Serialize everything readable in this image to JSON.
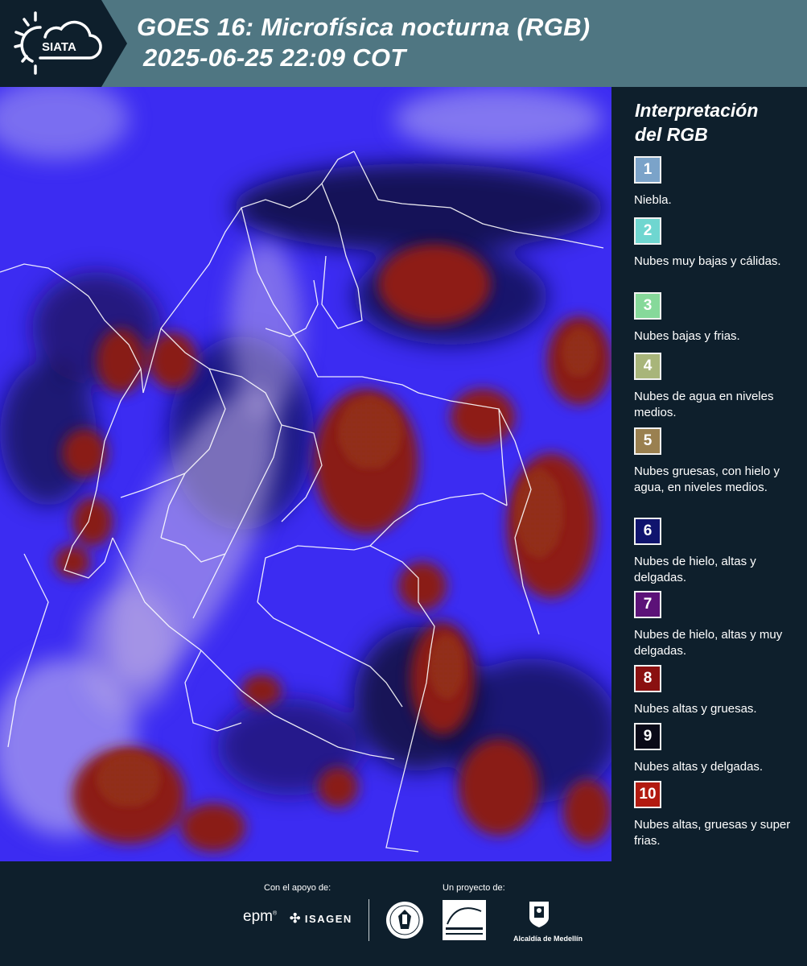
{
  "header": {
    "logo_text": "SIATA",
    "title_line1": "GOES 16: Microfísica nocturna (RGB)",
    "title_line2": "2025-06-25 22:09 COT",
    "background": "#4f7682"
  },
  "map": {
    "image_type": "Satellite night microphysics RGB composite",
    "base_color": "#3c2cf2"
  },
  "legend": {
    "title_line1": "Interpretación",
    "title_line2": "del RGB",
    "items": [
      {
        "number": "1",
        "label": "Niebla.",
        "color": "#7ba3c9"
      },
      {
        "number": "2",
        "label": "Nubes muy bajas y cálidas.",
        "color": "#6fd6d0"
      },
      {
        "number": "3",
        "label": "Nubes bajas y frias.",
        "color": "#86d99a"
      },
      {
        "number": "4",
        "label": "Nubes de agua en niveles medios.",
        "color": "#a8b57a"
      },
      {
        "number": "5",
        "label": "Nubes gruesas, con hielo y agua, en niveles medios.",
        "color": "#9a8050"
      },
      {
        "number": "6",
        "label": "Nubes de hielo, altas y delgadas.",
        "color": "#10146e"
      },
      {
        "number": "7",
        "label": "Nubes de hielo, altas y muy delgadas.",
        "color": "#5c1278"
      },
      {
        "number": "8",
        "label": "Nubes altas y gruesas.",
        "color": "#8a1010"
      },
      {
        "number": "9",
        "label": "Nubes altas y delgadas.",
        "color": "#0a0a18"
      },
      {
        "number": "10",
        "label": "Nubes altas, gruesas y super frias.",
        "color": "#b21a10"
      }
    ]
  },
  "footer": {
    "support_caption": "Con el apoyo de:",
    "project_caption": "Un proyecto de:",
    "epm_logo": "epm",
    "isagen_logo": "ISAGEN",
    "medellin_logo": "Alcaldía de Medellín"
  }
}
